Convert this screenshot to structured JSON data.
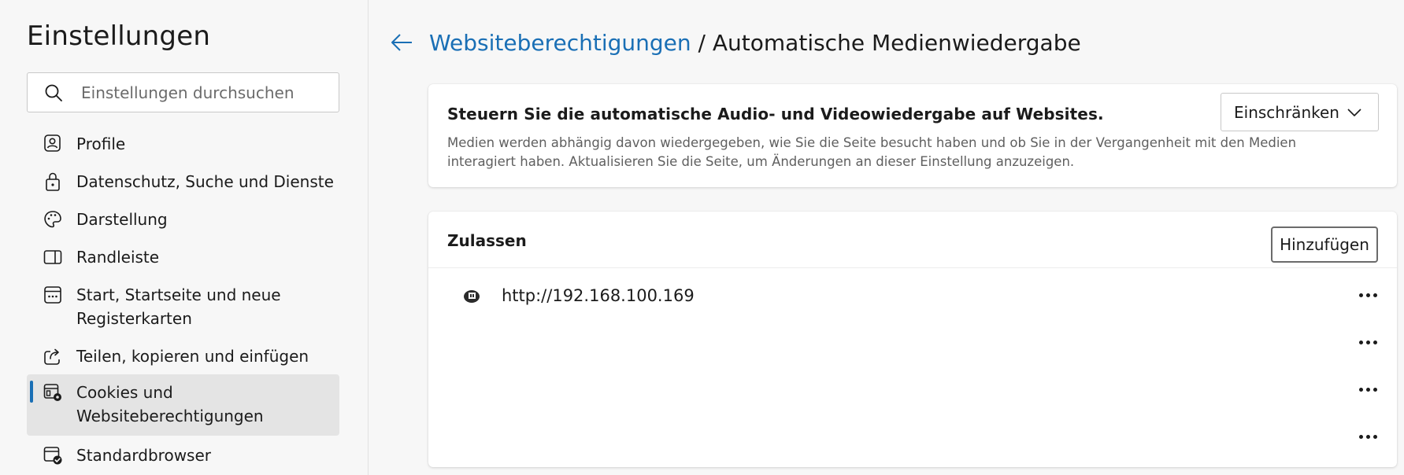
{
  "sidebar": {
    "title": "Einstellungen",
    "search_placeholder": "Einstellungen durchsuchen",
    "items": [
      {
        "label": "Profile",
        "icon": "profile-icon"
      },
      {
        "label": "Datenschutz, Suche und Dienste",
        "icon": "lock-icon"
      },
      {
        "label": "Darstellung",
        "icon": "palette-icon"
      },
      {
        "label": "Randleiste",
        "icon": "sidebar-icon"
      },
      {
        "label_line1": "Start, Startseite und neue",
        "label_line2": "Registerkarten",
        "icon": "start-page-icon"
      },
      {
        "label": "Teilen, kopieren und einfügen",
        "icon": "share-icon"
      },
      {
        "label_line1": "Cookies und",
        "label_line2": "Websiteberechtigungen",
        "icon": "cookies-permissions-icon",
        "active": true
      },
      {
        "label": "Standardbrowser",
        "icon": "default-browser-icon"
      }
    ]
  },
  "header": {
    "back_icon": "back-arrow-icon",
    "breadcrumb_link": "Websiteberechtigungen",
    "breadcrumb_rest": " / Automatische Medienwiedergabe"
  },
  "autoplay": {
    "heading": "Steuern Sie die automatische Audio- und Videowiedergabe auf Websites.",
    "description": "Medien werden abhängig davon wiedergegeben, wie Sie die Seite besucht haben und ob Sie in der Vergangenheit mit den Medien interagiert haben. Aktualisieren Sie die Seite, um Änderungen an dieser Einstellung anzuzeigen.",
    "selected_option": "Einschränken"
  },
  "allow": {
    "title": "Zulassen",
    "add_label": "Hinzufügen",
    "sites": [
      {
        "url": "http://192.168.100.169"
      }
    ]
  },
  "colors": {
    "accent": "#1a6fb5",
    "background": "#f7f7f7",
    "card": "#ffffff"
  }
}
